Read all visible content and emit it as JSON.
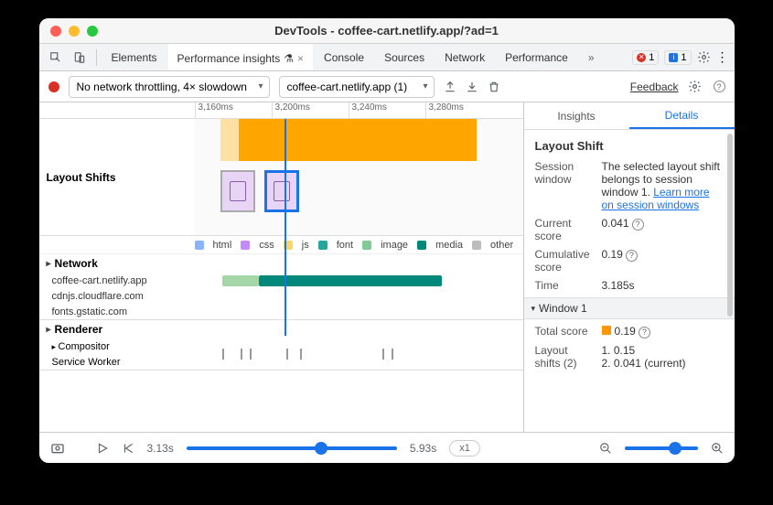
{
  "title": "DevTools - coffee-cart.netlify.app/?ad=1",
  "tabs": [
    "Elements",
    "Performance insights",
    "Console",
    "Sources",
    "Network",
    "Performance"
  ],
  "activeTabIndex": 1,
  "tabBadge": "▲",
  "errors": "1",
  "infos": "1",
  "toolbar": {
    "throttling": "No network throttling, 4× slowdown",
    "target": "coffee-cart.netlify.app (1)",
    "feedback": "Feedback"
  },
  "ruler": [
    "3,160ms",
    "3,200ms",
    "3,240ms",
    "3,280ms"
  ],
  "layoutShiftsLabel": "Layout Shifts",
  "legend": [
    {
      "label": "html",
      "color": "#8ab4f8"
    },
    {
      "label": "css",
      "color": "#c58af9"
    },
    {
      "label": "js",
      "color": "#fdd663"
    },
    {
      "label": "font",
      "color": "#26a69a"
    },
    {
      "label": "image",
      "color": "#81c995"
    },
    {
      "label": "media",
      "color": "#00897b"
    },
    {
      "label": "other",
      "color": "#bdbdbd"
    }
  ],
  "networkLabel": "Network",
  "networkHosts": [
    "coffee-cart.netlify.app",
    "cdnjs.cloudflare.com",
    "fonts.gstatic.com"
  ],
  "rendererLabel": "Renderer",
  "rendererRows": [
    "Compositor",
    "Service Worker"
  ],
  "sideTabs": {
    "insights": "Insights",
    "details": "Details"
  },
  "details": {
    "heading": "Layout Shift",
    "sessionWindow": {
      "k": "Session window",
      "v": "The selected layout shift belongs to session window 1. ",
      "link": "Learn more on session windows"
    },
    "currentScore": {
      "k": "Current score",
      "v": "0.041"
    },
    "cumulativeScore": {
      "k": "Cumulative score",
      "v": "0.19"
    },
    "time": {
      "k": "Time",
      "v": "3.185s"
    },
    "windowHead": "Window 1",
    "totalScore": {
      "k": "Total score",
      "v": "0.19"
    },
    "layoutShifts": {
      "k": "Layout shifts (2)",
      "v1": "1. 0.15",
      "v2": "2. 0.041 (current)"
    }
  },
  "footer": {
    "startTime": "3.13s",
    "endTime": "5.93s",
    "speed": "x1"
  }
}
